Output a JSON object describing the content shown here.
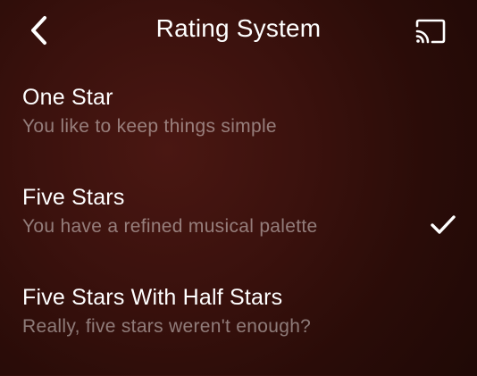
{
  "header": {
    "title": "Rating System",
    "back_icon": "chevron-left-icon",
    "cast_icon": "cast-icon"
  },
  "options": [
    {
      "label": "One Star",
      "description": "You like to keep things simple",
      "selected": false
    },
    {
      "label": "Five Stars",
      "description": "You have a refined musical palette",
      "selected": true
    },
    {
      "label": "Five Stars With Half Stars",
      "description": "Really, five stars weren't enough?",
      "selected": false
    }
  ],
  "colors": {
    "background_dark": "#1f0906",
    "background_mid": "#4a1712",
    "text_primary": "#ffffff",
    "text_secondary": "rgba(255,255,255,0.45)"
  }
}
